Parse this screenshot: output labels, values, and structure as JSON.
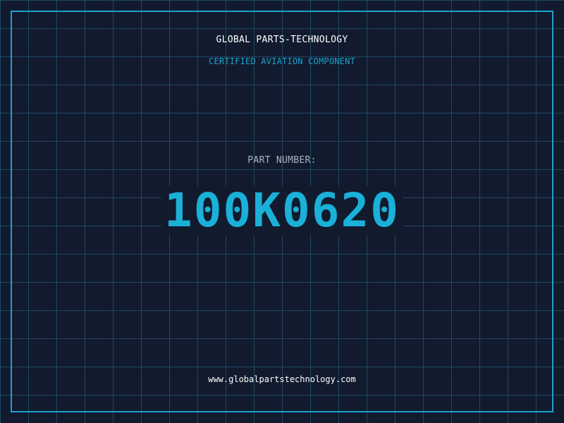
{
  "header": {
    "company": "GLOBAL PARTS-TECHNOLOGY",
    "subtitle": "CERTIFIED AVIATION COMPONENT"
  },
  "part": {
    "label": "PART NUMBER:",
    "number": "100K0620"
  },
  "footer": {
    "website": "www.globalpartstechnology.com"
  },
  "colors": {
    "background": "#121a2e",
    "accent": "#1aa3cf",
    "grid": "#286e8c",
    "text": "#ffffff"
  }
}
